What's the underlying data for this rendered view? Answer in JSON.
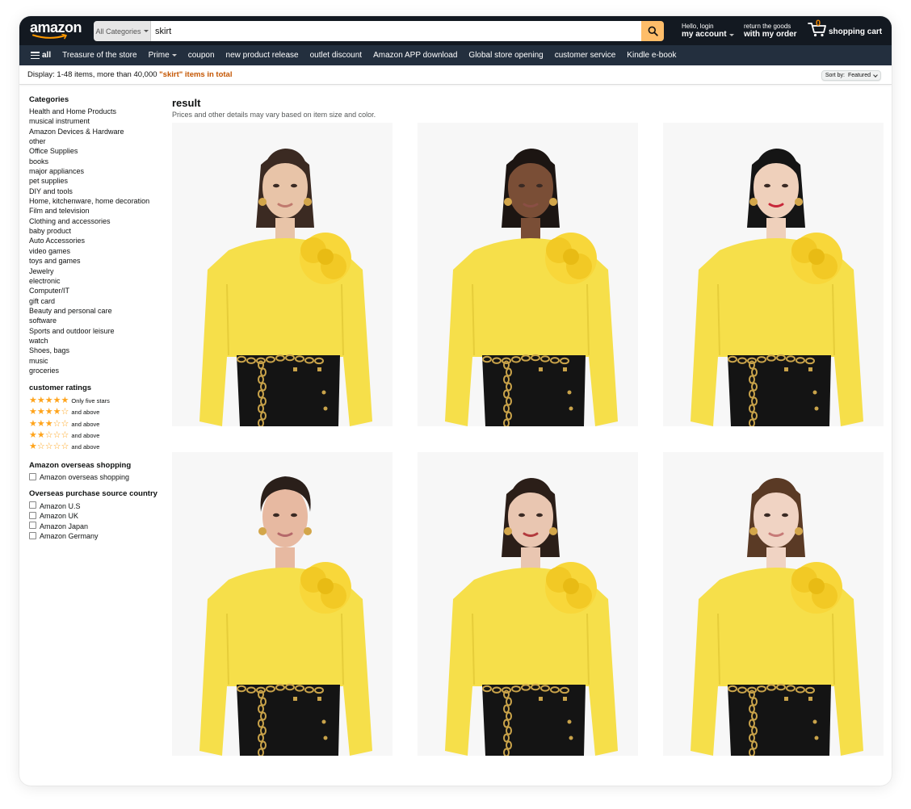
{
  "header": {
    "logo_text": "amazon",
    "search": {
      "category_label": "All Categories",
      "query": "skirt"
    },
    "account": {
      "line1": "Hello, login",
      "line2": "my account"
    },
    "orders": {
      "line1": "return the goods",
      "line2": "with my order"
    },
    "cart": {
      "count": "0",
      "label": "shopping cart"
    }
  },
  "nav": {
    "all_label": "all",
    "items": [
      "Treasure of the store",
      "Prime",
      "coupon",
      "new product release",
      "outlet discount",
      "Amazon APP download",
      "Global store opening",
      "customer service",
      "Kindle e-book"
    ]
  },
  "results_bar": {
    "prefix": "Display: 1-48 items, more than 40,000 ",
    "query_text": "\"skirt\" items in total",
    "sort_label": "Sort by:",
    "sort_value": "Featured"
  },
  "sidebar": {
    "categories_title": "Categories",
    "categories": [
      "Health and Home Products",
      "musical instrument",
      "Amazon Devices & Hardware",
      "other",
      "Office Supplies",
      "books",
      "major appliances",
      "pet supplies",
      "DIY and tools",
      "Home, kitchenware, home decoration",
      "Film and television",
      "Clothing and accessories",
      "baby product",
      "Auto Accessories",
      "video games",
      "toys and games",
      "Jewelry",
      "electronic",
      "Computer/IT",
      "gift card",
      "Beauty and personal care",
      "software",
      "Sports and outdoor leisure",
      "watch",
      "Shoes, bags",
      "music",
      "groceries"
    ],
    "ratings_title": "customer ratings",
    "ratings": [
      {
        "stars": 5,
        "label": "Only five stars"
      },
      {
        "stars": 4,
        "label": "and above"
      },
      {
        "stars": 3,
        "label": "and above"
      },
      {
        "stars": 2,
        "label": "and above"
      },
      {
        "stars": 1,
        "label": "and above"
      }
    ],
    "overseas_title": "Amazon overseas shopping",
    "overseas_option": "Amazon overseas shopping",
    "source_title": "Overseas purchase source country",
    "source_options": [
      "Amazon U.S",
      "Amazon UK",
      "Amazon Japan",
      "Amazon Germany"
    ]
  },
  "results": {
    "title": "result",
    "subtitle": "Prices and other details may vary based on item size and color.",
    "products": [
      {
        "model": "model-1",
        "skin": "#e8c4a8",
        "hair": "#3b2a22",
        "lips": "#c07a6e"
      },
      {
        "model": "model-2",
        "skin": "#7a4e36",
        "hair": "#1c1512",
        "lips": "#8a4f45"
      },
      {
        "model": "model-3",
        "skin": "#efd0bb",
        "hair": "#151515",
        "lips": "#c8283a"
      },
      {
        "model": "model-4",
        "skin": "#e7b9a1",
        "hair": "#2a1f1a",
        "lips": "#b5686a"
      },
      {
        "model": "model-5",
        "skin": "#e9c6b1",
        "hair": "#2b1e18",
        "lips": "#b23a3d"
      },
      {
        "model": "model-6",
        "skin": "#f0d3c3",
        "hair": "#5a3a25",
        "lips": "#c77b78"
      }
    ]
  },
  "colors": {
    "header_bg": "#131921",
    "nav_bg": "#232f3e",
    "search_button": "#febd69",
    "accent_orange": "#c45500",
    "star": "#ffa41c",
    "sweater": "#f6df4a",
    "skirt": "#141414",
    "chain": "#c9a34a"
  }
}
